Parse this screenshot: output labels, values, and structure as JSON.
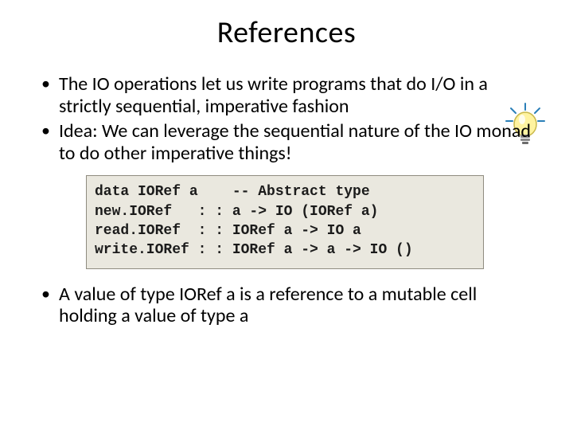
{
  "title": "References",
  "bullets": {
    "b1": "The IO operations let us write programs that do I/O in a strictly sequential, imperative fashion",
    "b2": "Idea: We can leverage the sequential nature of the IO monad to do other imperative things!",
    "b3": "A value of type IORef a is a reference to a mutable cell holding a value of type a"
  },
  "code": "data IORef a    -- Abstract type\nnew.IORef   : : a -> IO (IORef a)\nread.IORef  : : IORef a -> IO a\nwrite.IORef : : IORef a -> a -> IO ()",
  "icon": "lightbulb-idea"
}
